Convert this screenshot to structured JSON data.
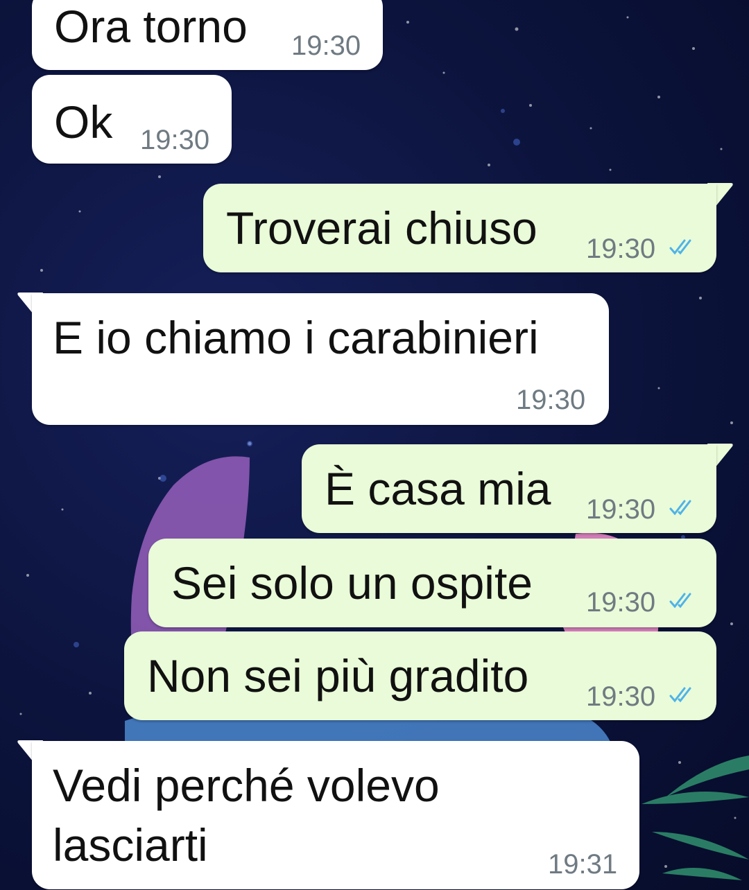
{
  "chat": {
    "messages": [
      {
        "direction": "incoming",
        "text": "Ora torno",
        "time": "19:30"
      },
      {
        "direction": "incoming",
        "text": "Ok",
        "time": "19:30"
      },
      {
        "direction": "outgoing",
        "text": "Troverai chiuso",
        "time": "19:30",
        "status_icon": "double-check-read-icon"
      },
      {
        "direction": "incoming",
        "text": "E io chiamo i carabinieri",
        "time": "19:30"
      },
      {
        "direction": "outgoing",
        "text": "È casa mia",
        "time": "19:30",
        "status_icon": "double-check-read-icon"
      },
      {
        "direction": "outgoing",
        "text": "Sei solo un ospite",
        "time": "19:30",
        "status_icon": "double-check-read-icon"
      },
      {
        "direction": "outgoing",
        "text": "Non sei più gradito",
        "time": "19:30",
        "status_icon": "double-check-read-icon"
      },
      {
        "direction": "incoming",
        "text_lines": [
          "Vedi perché volevo",
          "lasciarti"
        ],
        "time": "19:31"
      }
    ]
  },
  "colors": {
    "incoming_bubble": "#ffffff",
    "outgoing_bubble": "#e9fbd8",
    "read_ticks": "#4fb3e8",
    "timestamp": "#6f7a82",
    "wallpaper": "#0d1540"
  }
}
